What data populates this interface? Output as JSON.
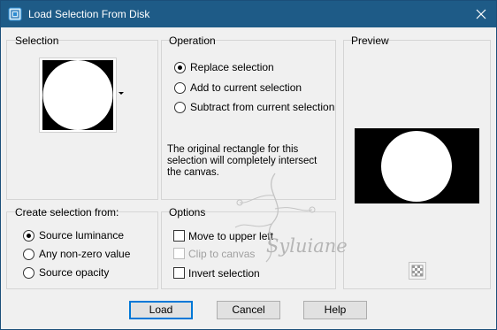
{
  "window": {
    "title": "Load Selection From Disk",
    "accent": "#1e5b87"
  },
  "selection": {
    "label": "Selection"
  },
  "operation": {
    "label": "Operation",
    "options": [
      {
        "label": "Replace selection",
        "checked": true
      },
      {
        "label": "Add to current selection",
        "checked": false
      },
      {
        "label": "Subtract from current selection",
        "checked": false
      }
    ],
    "info_line1": "The original rectangle for this",
    "info_line2": "selection will completely intersect",
    "info_line3": "the canvas."
  },
  "preview": {
    "label": "Preview"
  },
  "create_from": {
    "label": "Create selection from:",
    "options": [
      {
        "label": "Source luminance",
        "checked": true
      },
      {
        "label": "Any non-zero value",
        "checked": false
      },
      {
        "label": "Source opacity",
        "checked": false
      }
    ]
  },
  "options": {
    "label": "Options",
    "items": [
      {
        "label": "Move to upper left",
        "checked": false,
        "enabled": true
      },
      {
        "label": "Clip to canvas",
        "checked": false,
        "enabled": false
      },
      {
        "label": "Invert selection",
        "checked": false,
        "enabled": true
      }
    ]
  },
  "watermark": {
    "text": "Syluiane"
  },
  "buttons": {
    "load": "Load",
    "cancel": "Cancel",
    "help": "Help"
  }
}
